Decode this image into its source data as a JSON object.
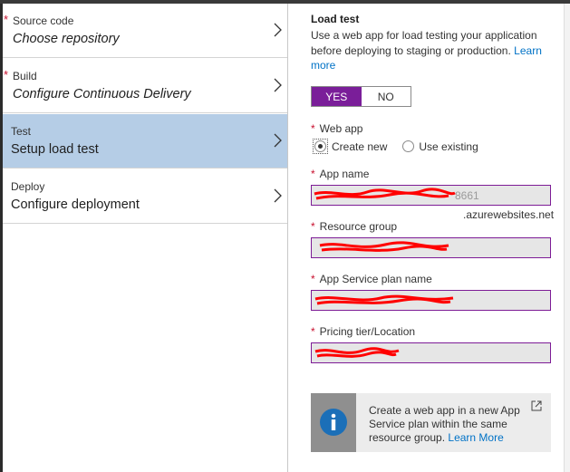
{
  "steps": [
    {
      "title": "Source code",
      "value": "Choose repository",
      "required": "*"
    },
    {
      "title": "Build",
      "value": "Configure Continuous Delivery",
      "required": "*"
    },
    {
      "title": "Test",
      "value": "Setup load test",
      "required": ""
    },
    {
      "title": "Deploy",
      "value": "Configure deployment",
      "required": ""
    }
  ],
  "load_test": {
    "title": "Load test",
    "description": "Use a web app for load testing your application before deploying to staging or production.",
    "learn_more": "Learn more",
    "yes_label": "YES",
    "no_label": "NO",
    "selected": "YES"
  },
  "web_app": {
    "label": "Web app",
    "create_new": "Create new",
    "use_existing": "Use existing",
    "selected": "Create new"
  },
  "fields": {
    "app_name_label": "App name",
    "app_name_visible_fragment": "8661",
    "app_name_suffix": ".azurewebsites.net",
    "resource_group_label": "Resource group",
    "app_service_plan_label": "App Service plan name",
    "pricing_tier_label": "Pricing tier/Location"
  },
  "info": {
    "text": "Create a web app in a new App Service plan within the same resource group.",
    "learn_more": "Learn More"
  },
  "colors": {
    "accent": "#7a1e99",
    "selected_step": "#b5cde6",
    "link": "#0072c6",
    "required_star": "#c8102e",
    "redaction": "#ff0000"
  }
}
